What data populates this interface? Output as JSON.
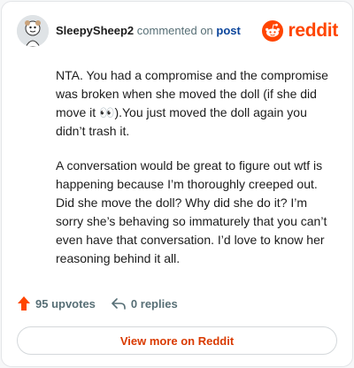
{
  "header": {
    "username": "SleepySheep2",
    "commented_text": "commented on",
    "post_link": "post",
    "brand": "reddit"
  },
  "comment": {
    "paragraph_1": "NTA. You had a compromise and the compromise was broken when she moved the doll (if she did move it 👀).You just moved the doll again you didn’t trash it.",
    "paragraph_2": "A conversation would be great to figure out wtf is happening because I’m thoroughly creeped out. Did she move the doll? Why did she do it? I’m sorry she’s behaving so immaturely that you can’t even have that conversation. I’d love to know her reasoning behind it all."
  },
  "footer": {
    "upvotes": "95 upvotes",
    "replies": "0 replies"
  },
  "view_more": "View more on Reddit",
  "colors": {
    "brand": "#ff4500",
    "link": "#0a449b",
    "muted": "#576f76",
    "view_more": "#d93a00"
  },
  "icons": [
    "avatar",
    "reddit-logo-icon",
    "upvote-arrow-icon",
    "reply-arrow-icon"
  ]
}
